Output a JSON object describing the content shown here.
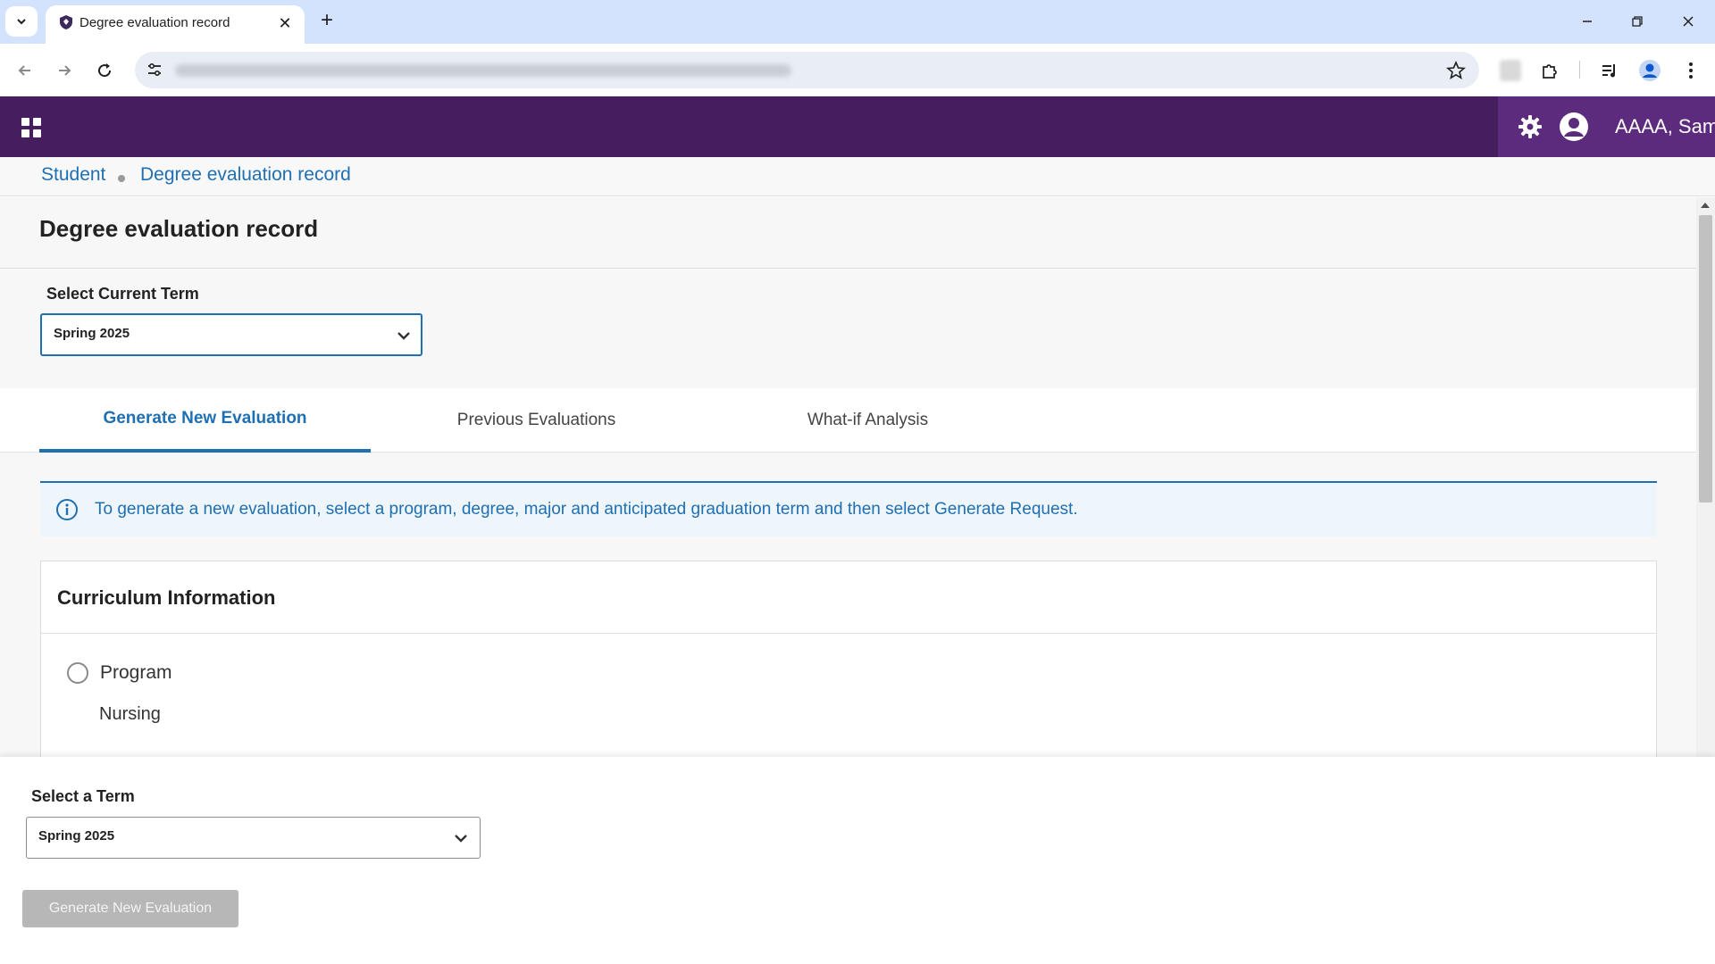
{
  "browser": {
    "tab_title": "Degree evaluation record",
    "new_tab_symbol": "+",
    "close_symbol": "✕"
  },
  "app_header": {
    "user_name": "AAAA, Sam",
    "background": "#461d5e",
    "accent_background": "#5d2b7d"
  },
  "breadcrumb": {
    "items": [
      "Student",
      "Degree evaluation record"
    ]
  },
  "page": {
    "title": "Degree evaluation record",
    "current_term": {
      "label": "Select Current Term",
      "value": "Spring 2025"
    }
  },
  "tabs": [
    {
      "label": "Generate New Evaluation",
      "active": true
    },
    {
      "label": "Previous Evaluations",
      "active": false
    },
    {
      "label": "What-if Analysis",
      "active": false
    }
  ],
  "info_banner": {
    "icon": "info-icon",
    "text": "To generate a new evaluation, select a program, degree, major and anticipated graduation term and then select Generate Request."
  },
  "curriculum": {
    "title": "Curriculum Information",
    "program": {
      "label": "Program",
      "value": "Nursing",
      "selected": false
    }
  },
  "footer": {
    "term_label": "Select a Term",
    "term_value": "Spring 2025",
    "generate_button": "Generate New Evaluation",
    "generate_enabled": false
  },
  "colors": {
    "link_blue": "#1f6fb3",
    "disabled_button": "#b7b7b7"
  }
}
